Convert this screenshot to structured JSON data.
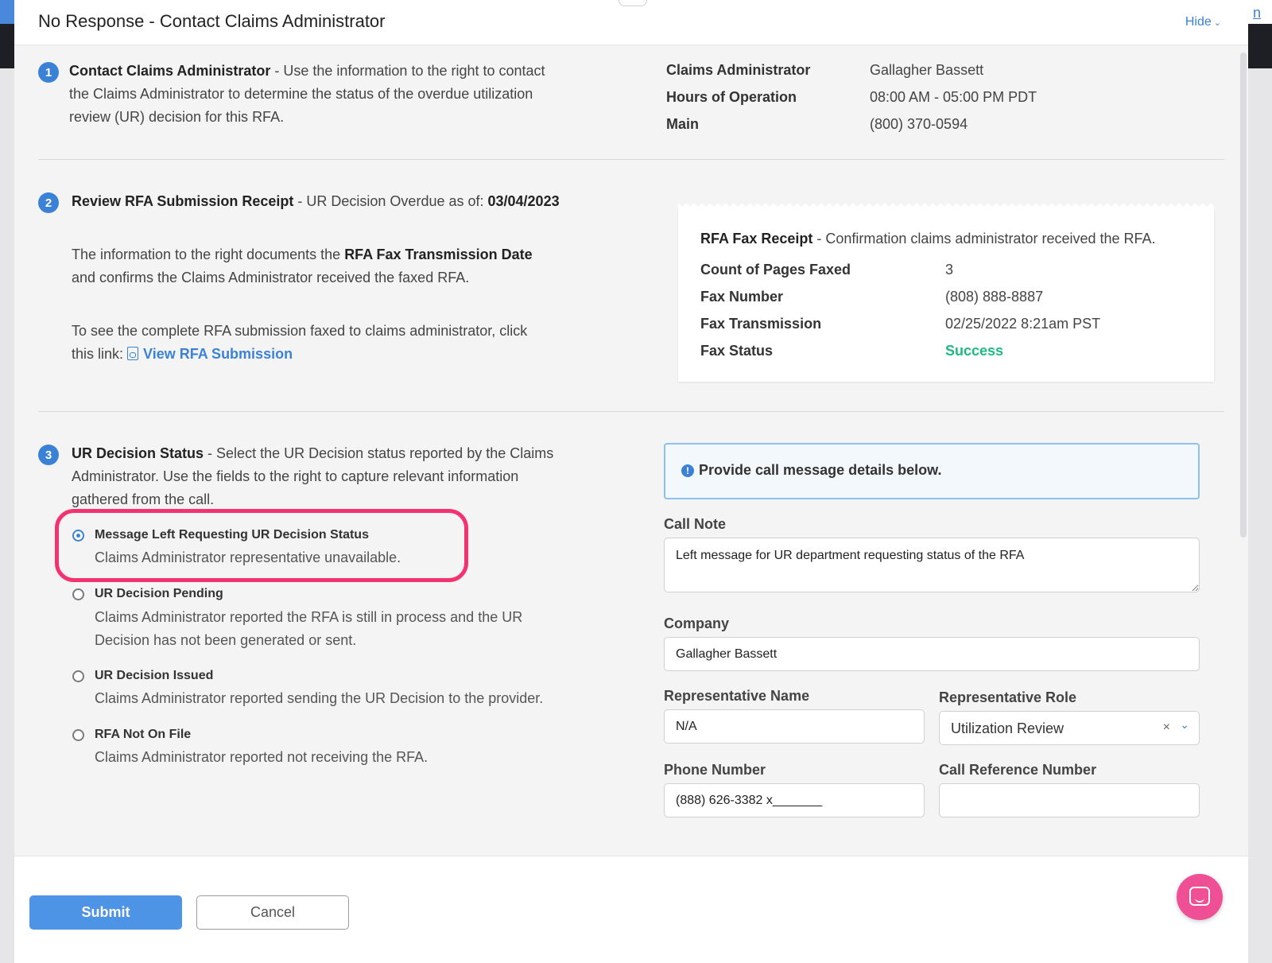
{
  "modal": {
    "title": "No Response - Contact Claims Administrator",
    "hide_label": "Hide",
    "background_link": "n"
  },
  "step1": {
    "number": "1",
    "heading": "Contact Claims Administrator",
    "text_line1": " - Use the information to the right to contact",
    "text_line2": "the Claims Administrator to determine the status of the overdue utilization",
    "text_line3": "review (UR) decision for this RFA.",
    "details": [
      {
        "label": "Claims Administrator",
        "value": "Gallagher Bassett"
      },
      {
        "label": "Hours of Operation",
        "value": "08:00 AM - 05:00 PM PDT"
      },
      {
        "label": "Main",
        "value": "(800) 370-0594"
      }
    ]
  },
  "step2": {
    "number": "2",
    "heading": "Review RFA Submission Receipt",
    "overdue_prefix": " - UR Decision Overdue as of: ",
    "overdue_date": "03/04/2023",
    "info_line1_prefix": "The information to the right documents the ",
    "info_line1_bold": "RFA Fax Transmission Date",
    "info_line2": "and confirms the Claims Administrator received the faxed RFA.",
    "see_line1": "To see the complete RFA submission faxed to claims administrator, click",
    "see_line2_prefix": "this link: ",
    "view_link": "View RFA Submission",
    "receipt": {
      "title": "RFA Fax Receipt",
      "subtitle": " - Confirmation claims administrator received the RFA.",
      "rows": [
        {
          "label": "Count of Pages Faxed",
          "value": "3"
        },
        {
          "label": "Fax Number",
          "value": "(808) 888-8887"
        },
        {
          "label": "Fax Transmission",
          "value": "02/25/2022 8:21am PST"
        },
        {
          "label": "Fax Status",
          "value": "Success"
        }
      ],
      "status_color": "#1fb981"
    }
  },
  "step3": {
    "number": "3",
    "heading": "UR Decision Status",
    "text_line1": " - Select the UR Decision status reported by the Claims",
    "text_line2": "Administrator. Use the fields to the right to capture relevant information",
    "text_line3": "gathered from the call.",
    "options": [
      {
        "title": "Message Left Requesting UR Decision Status",
        "desc1": "Claims Administrator representative unavailable.",
        "desc2": "",
        "selected": true
      },
      {
        "title": "UR Decision Pending",
        "desc1": "Claims Administrator reported the RFA is still in process and the UR",
        "desc2": "Decision has not been generated or sent.",
        "selected": false
      },
      {
        "title": "UR Decision Issued",
        "desc1": "Claims Administrator reported sending the UR Decision to the provider.",
        "desc2": "",
        "selected": false
      },
      {
        "title": "RFA Not On File",
        "desc1": "Claims Administrator reported not receiving the RFA.",
        "desc2": "",
        "selected": false
      }
    ],
    "highlight_color": "#f2336f"
  },
  "form": {
    "info_message": "Provide call message details below.",
    "call_note": {
      "label": "Call Note",
      "value": "Left message for UR department requesting status of the RFA"
    },
    "company": {
      "label": "Company",
      "value": "Gallagher Bassett"
    },
    "rep_name": {
      "label": "Representative Name",
      "value": "N/A"
    },
    "rep_role": {
      "label": "Representative Role",
      "value": "Utilization Review"
    },
    "phone": {
      "label": "Phone Number",
      "value": "(888) 626-3382 x_______"
    },
    "call_ref": {
      "label": "Call Reference Number",
      "value": ""
    }
  },
  "footer": {
    "submit_label": "Submit",
    "cancel_label": "Cancel"
  },
  "icons": {
    "info": "info-circle-icon",
    "pdf": "pdf-file-icon",
    "chevron": "chevron-down-icon",
    "clear": "clear-x-icon",
    "chat": "chat-bubble-icon"
  },
  "colors": {
    "accent": "#3b82d6",
    "primary_button": "#4d93e6",
    "chat": "#ee4f95"
  }
}
